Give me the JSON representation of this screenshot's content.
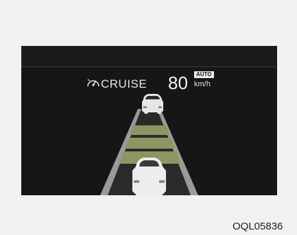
{
  "cluster": {
    "cruise_label": "CRUISE",
    "speed_value": "80",
    "auto_badge": "AUTO",
    "speed_unit": "km/h"
  },
  "icons": {
    "cruise": "speedometer-cruise-icon",
    "lead_vehicle": "car-rear-icon",
    "own_vehicle": "car-rear-icon"
  },
  "distance_setting": {
    "bars_lit": 3,
    "bars_total": 3
  },
  "colors": {
    "screen_background": "#161616",
    "distance_bar": "#8f9561",
    "lane_line": "#9a9a9a",
    "text": "#e8e8e8"
  },
  "figure_code": "OQL05836"
}
